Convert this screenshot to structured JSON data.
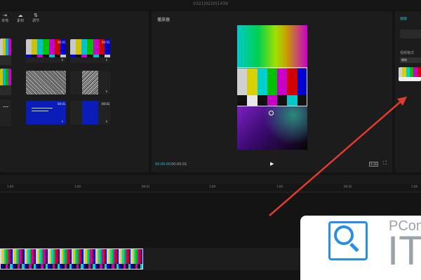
{
  "titlebar": {
    "title": "0321|0220|1439"
  },
  "media": {
    "tools": [
      {
        "icon": "import-icon",
        "glyph": "⇥",
        "label": "本地"
      },
      {
        "icon": "cloud-icon",
        "glyph": "☁",
        "label": "素材"
      },
      {
        "icon": "adjust-icon",
        "glyph": "⇅",
        "label": "调节"
      }
    ],
    "durations": [
      "00:01",
      "00:01",
      "00:01",
      "00:01"
    ],
    "download_glyph": "⭳"
  },
  "player": {
    "title": "播放器",
    "time_current": "00:00:00",
    "time_total": "00:00:01",
    "play_glyph": "▶",
    "ratio_label": "9:16",
    "fullscreen_glyph": "⛶"
  },
  "properties": {
    "tab": "画面",
    "label": "视频格式",
    "select_value": "缩放"
  },
  "ruler": {
    "ticks": [
      "1:00",
      "1:00",
      "00:01",
      "1:00",
      "1:00",
      "00:02",
      "1:00"
    ]
  },
  "watermark": {
    "brand_small": "PCon",
    "brand_large": "IT"
  },
  "colors": {
    "accent": "#26bfd0",
    "arrow": "#e23b2e",
    "watermark_blue": "#2a8ee6"
  }
}
